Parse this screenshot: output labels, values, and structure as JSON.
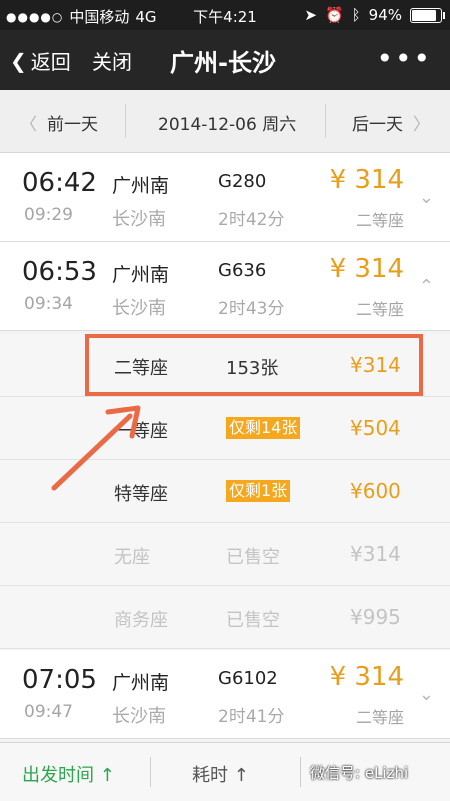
{
  "status_bar": {
    "signal": "●●●●○",
    "carrier": "中国移动",
    "network": "4G",
    "time": "下午4:21",
    "battery": "94%",
    "battery_level": 0.94
  },
  "nav": {
    "back": "返回",
    "close": "关闭",
    "title": "广州-长沙",
    "more": "•••"
  },
  "date_bar": {
    "prev": "前一天",
    "date": "2014-12-06 周六",
    "next": "后一天"
  },
  "trains": [
    {
      "dep": "06:42",
      "arr": "09:29",
      "from": "广州南",
      "to": "长沙南",
      "no": "G280",
      "dur": "2时42分",
      "price": "¥ 314",
      "cls": "二等座",
      "toggle": "⌄"
    },
    {
      "dep": "06:53",
      "arr": "09:34",
      "from": "广州南",
      "to": "长沙南",
      "no": "G636",
      "dur": "2时43分",
      "price": "¥ 314",
      "cls": "二等座",
      "toggle": "⌃"
    },
    {
      "dep": "07:05",
      "arr": "09:47",
      "from": "广州南",
      "to": "长沙南",
      "no": "G6102",
      "dur": "2时41分",
      "price": "¥ 314",
      "cls": "二等座",
      "toggle": "⌄"
    }
  ],
  "seats": [
    {
      "name": "二等座",
      "avail": "153张",
      "price": "¥314"
    },
    {
      "name": "一等座",
      "avail": "仅剩14张",
      "price": "¥504"
    },
    {
      "name": "特等座",
      "avail": "仅剩1张",
      "price": "¥600"
    },
    {
      "name": "无座",
      "avail": "已售空",
      "price": "¥314"
    },
    {
      "name": "商务座",
      "avail": "已售空",
      "price": "¥995"
    }
  ],
  "bottom_bar": {
    "sort_departure": "出发时间 ↑",
    "sort_duration": "耗时 ↑",
    "watermark": "微信号: eLizhi"
  },
  "colors": {
    "price": "#e89e1a",
    "highlight": "#ea6a45",
    "active_sort": "#2da44e"
  }
}
